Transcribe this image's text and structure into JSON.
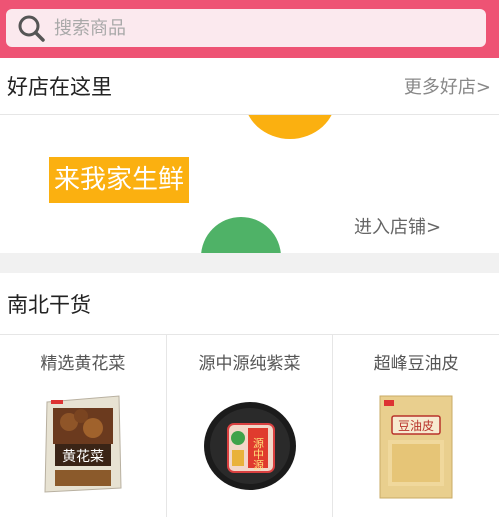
{
  "search": {
    "placeholder": "搜索商品"
  },
  "shops_section": {
    "title": "好店在这里",
    "more_label": "更多好店>"
  },
  "shop_banner": {
    "shop_name": "来我家生鲜",
    "enter_label": "进入店铺>"
  },
  "dry_goods_section": {
    "title": "南北干货"
  },
  "products": [
    {
      "name": "精选黄花菜",
      "package_text": "黄花菜"
    },
    {
      "name": "源中源纯紫菜",
      "package_text": "源中源"
    },
    {
      "name": "超峰豆油皮",
      "package_text": "豆油皮"
    }
  ],
  "colors": {
    "header": "#ee5374",
    "banner_orange": "#fbb010",
    "banner_green": "#4fb267"
  }
}
